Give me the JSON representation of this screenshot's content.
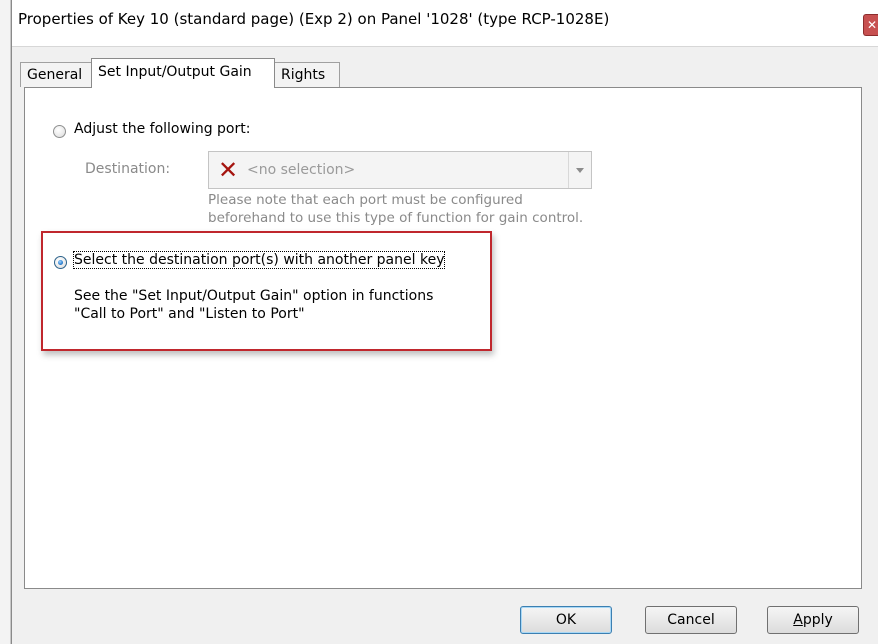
{
  "window": {
    "title": "Properties of Key 10 (standard page) (Exp 2) on Panel '1028' (type RCP-1028E)",
    "close_icon": "close-icon"
  },
  "tabs": [
    {
      "label": "General",
      "active": false
    },
    {
      "label": "Set Input/Output Gain",
      "active": true
    },
    {
      "label": "Rights",
      "active": false
    }
  ],
  "option_adjust": {
    "label": "Adjust the following port:",
    "selected": false,
    "destination_label": "Destination:",
    "destination_value": "<no selection>",
    "destination_icon": "red-x-icon",
    "note_line1": "Please note that each port must be configured",
    "note_line2": "beforehand to use this type of function for gain control."
  },
  "option_select": {
    "label": "Select the destination port(s) with another panel key",
    "selected": true,
    "info_line1": "See the \"Set Input/Output Gain\" option in functions",
    "info_line2": "\"Call to Port\" and \"Listen to Port\"",
    "highlight_color": "#c0272d"
  },
  "buttons": {
    "ok": "OK",
    "cancel": "Cancel",
    "apply": "Apply"
  }
}
